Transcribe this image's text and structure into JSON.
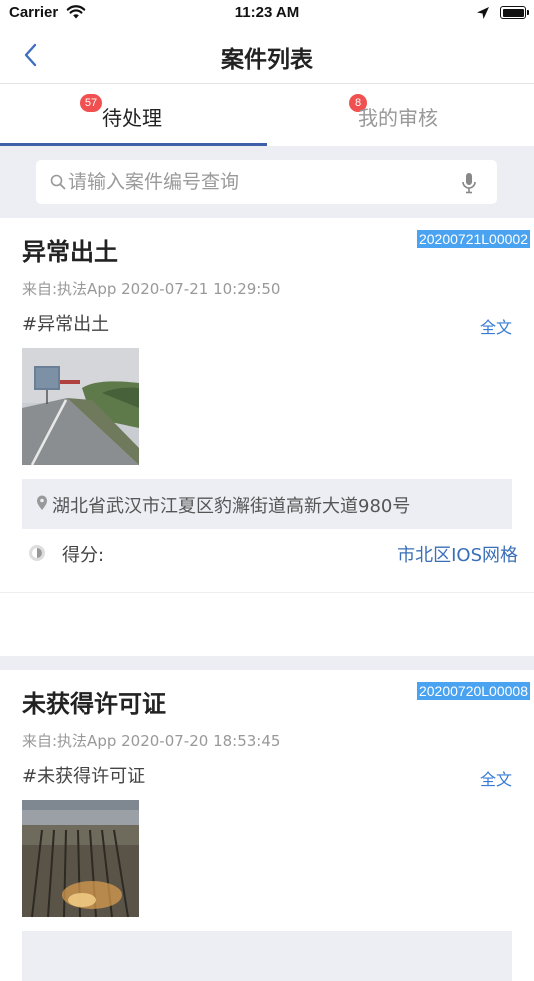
{
  "status_bar": {
    "carrier": "Carrier",
    "time": "11:23 AM"
  },
  "nav": {
    "title": "案件列表"
  },
  "tabs": [
    {
      "label": "待处理",
      "badge": "57",
      "active": true
    },
    {
      "label": "我的审核",
      "badge": "8",
      "active": false
    }
  ],
  "search": {
    "placeholder": "请输入案件编号查询",
    "value": ""
  },
  "cases": [
    {
      "title": "异常出土",
      "code": "20200721L00002",
      "source": "来自:执法App 2020-07-21 10:29:50",
      "tag": "#异常出土",
      "fulltext": "全文",
      "address": "湖北省武汉市江夏区豹澥街道高新大道980号",
      "score_label": "得分:",
      "grid": "市北区IOS网格",
      "thumb_icon": "road-photo"
    },
    {
      "title": "未获得许可证",
      "code": "20200720L00008",
      "source": "来自:执法App 2020-07-20 18:53:45",
      "tag": "#未获得许可证",
      "fulltext": "全文",
      "thumb_icon": "construction-photo"
    }
  ],
  "colors": {
    "accent": "#3f5fa8",
    "badge": "#f05050",
    "code_highlight": "#4aa3f0",
    "link": "#3a7bd5",
    "background_gray": "#eceef3"
  }
}
